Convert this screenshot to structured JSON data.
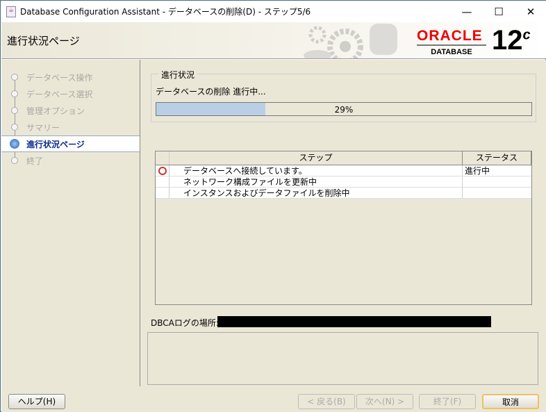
{
  "window": {
    "title": "Database Configuration Assistant - データベースの削除(D) - ステップ5/6",
    "minimize": "—",
    "maximize": "☐",
    "close": "✕"
  },
  "header": {
    "page_title": "進行状況ページ",
    "brand": "ORACLE",
    "product": "DATABASE",
    "version": "12",
    "version_sup": "c"
  },
  "steps": [
    {
      "label": "データベース操作",
      "active": false
    },
    {
      "label": "データベース選択",
      "active": false
    },
    {
      "label": "管理オプション",
      "active": false
    },
    {
      "label": "サマリー",
      "active": false
    },
    {
      "label": "進行状況ページ",
      "active": true
    },
    {
      "label": "終了",
      "active": false
    }
  ],
  "progress": {
    "group_label": "進行状況",
    "message": "データベースの削除 進行中...",
    "percent": 29,
    "percent_label": "29%"
  },
  "table": {
    "headers": [
      "ステップ",
      "ステータス"
    ],
    "rows": [
      {
        "step": "データベースへ接続しています。",
        "status": "進行中",
        "icon": "clock-icon"
      },
      {
        "step": "ネットワーク構成ファイルを更新中",
        "status": ""
      },
      {
        "step": "インスタンスおよびデータファイルを削除中",
        "status": ""
      }
    ]
  },
  "log": {
    "label": "DBCAログの場所:"
  },
  "buttons": {
    "help": "ヘルプ(H)",
    "back": "< 戻る(B)",
    "next": "次へ(N) >",
    "finish": "終了(F)",
    "cancel": "取消"
  }
}
